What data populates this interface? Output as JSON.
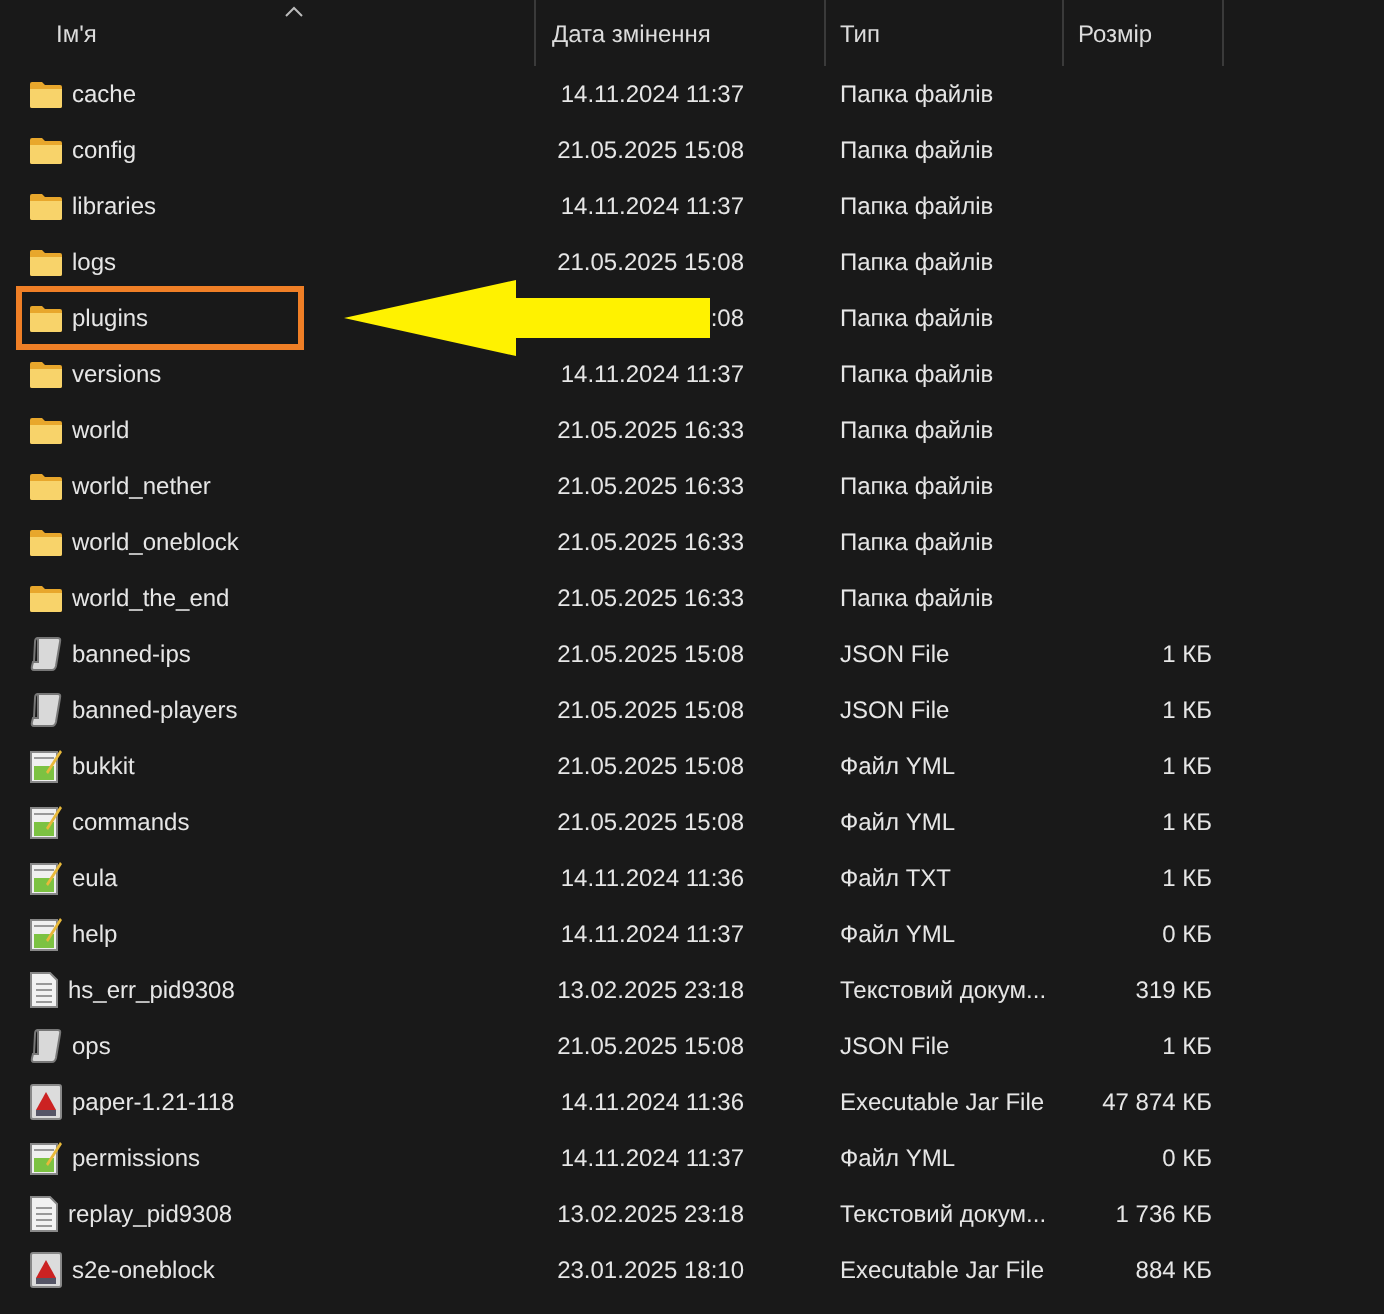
{
  "columns": [
    {
      "label": "Ім'я",
      "sorted": true
    },
    {
      "label": "Дата змінення",
      "sorted": false
    },
    {
      "label": "Тип",
      "sorted": false
    },
    {
      "label": "Розмір",
      "sorted": false
    }
  ],
  "rows": [
    {
      "kind": "folder",
      "name": "cache",
      "date": "14.11.2024 11:37",
      "type": "Папка файлів",
      "highlighted": false
    },
    {
      "kind": "folder",
      "name": "config",
      "date": "21.05.2025 15:08",
      "type": "Папка файлів",
      "highlighted": false
    },
    {
      "kind": "folder",
      "name": "libraries",
      "date": "14.11.2024 11:37",
      "type": "Папка файлів",
      "highlighted": false
    },
    {
      "kind": "folder",
      "name": "logs",
      "date": "21.05.2025 15:08",
      "type": "Папка файлів",
      "highlighted": false
    },
    {
      "kind": "folder",
      "name": "plugins",
      "date": ":08",
      "type": "Папка файлів",
      "highlighted": true
    },
    {
      "kind": "folder",
      "name": "versions",
      "date": "14.11.2024 11:37",
      "type": "Папка файлів",
      "highlighted": false
    },
    {
      "kind": "folder",
      "name": "world",
      "date": "21.05.2025 16:33",
      "type": "Папка файлів",
      "highlighted": false
    },
    {
      "kind": "folder",
      "name": "world_nether",
      "date": "21.05.2025 16:33",
      "type": "Папка файлів",
      "highlighted": false
    },
    {
      "kind": "folder",
      "name": "world_oneblock",
      "date": "21.05.2025 16:33",
      "type": "Папка файлів",
      "highlighted": false
    },
    {
      "kind": "folder",
      "name": "world_the_end",
      "date": "21.05.2025 16:33",
      "type": "Папка файлів",
      "highlighted": false
    },
    {
      "kind": "json",
      "name": "banned-ips",
      "date": "21.05.2025 15:08",
      "type": "JSON File",
      "size": "1 КБ",
      "highlighted": false
    },
    {
      "kind": "json",
      "name": "banned-players",
      "date": "21.05.2025 15:08",
      "type": "JSON File",
      "size": "1 КБ",
      "highlighted": false
    },
    {
      "kind": "notepad",
      "name": "bukkit",
      "date": "21.05.2025 15:08",
      "type": "Файл YML",
      "size": "1 КБ",
      "highlighted": false
    },
    {
      "kind": "notepad",
      "name": "commands",
      "date": "21.05.2025 15:08",
      "type": "Файл YML",
      "size": "1 КБ",
      "highlighted": false
    },
    {
      "kind": "notepad",
      "name": "eula",
      "date": "14.11.2024 11:36",
      "type": "Файл TXT",
      "size": "1 КБ",
      "highlighted": false
    },
    {
      "kind": "notepad",
      "name": "help",
      "date": "14.11.2024 11:37",
      "type": "Файл YML",
      "size": "0 КБ",
      "highlighted": false
    },
    {
      "kind": "text",
      "name": "hs_err_pid9308",
      "date": "13.02.2025 23:18",
      "type": "Текстовий докум...",
      "size": "319 КБ",
      "highlighted": false
    },
    {
      "kind": "json",
      "name": "ops",
      "date": "21.05.2025 15:08",
      "type": "JSON File",
      "size": "1 КБ",
      "highlighted": false
    },
    {
      "kind": "jar",
      "name": "paper-1.21-118",
      "date": "14.11.2024 11:36",
      "type": "Executable Jar File",
      "size": "47 874 КБ",
      "highlighted": false
    },
    {
      "kind": "notepad",
      "name": "permissions",
      "date": "14.11.2024 11:37",
      "type": "Файл YML",
      "size": "0 КБ",
      "highlighted": false
    },
    {
      "kind": "text",
      "name": "replay_pid9308",
      "date": "13.02.2025 23:18",
      "type": "Текстовий докум...",
      "size": "1 736 КБ",
      "highlighted": false
    },
    {
      "kind": "jar",
      "name": "s2e-oneblock",
      "date": "23.01.2025 18:10",
      "type": "Executable Jar File",
      "size": "884 КБ",
      "highlighted": false
    }
  ]
}
